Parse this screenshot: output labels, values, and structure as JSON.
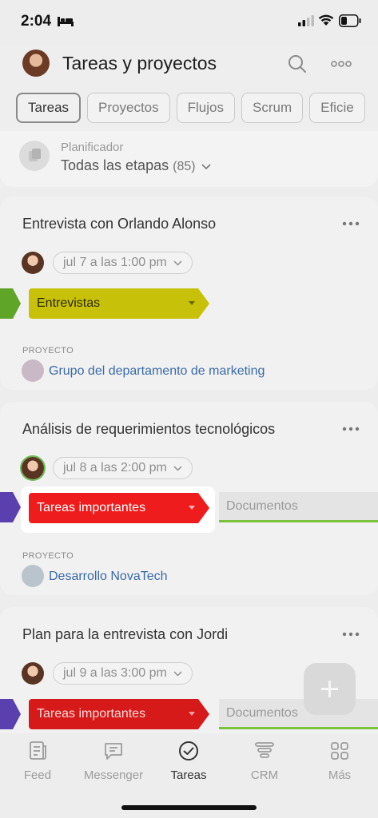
{
  "status_bar": {
    "time": "2:04"
  },
  "header": {
    "title": "Tareas y proyectos",
    "tabs": [
      {
        "label": "Tareas",
        "active": true
      },
      {
        "label": "Proyectos",
        "active": false
      },
      {
        "label": "Flujos",
        "active": false
      },
      {
        "label": "Scrum",
        "active": false
      },
      {
        "label": "Eficie",
        "active": false
      }
    ],
    "planner": {
      "label": "Planificador",
      "value": "Todas las etapas",
      "count": "(85)"
    }
  },
  "tasks": [
    {
      "title": "Entrevista con Orlando Alonso",
      "date": "jul 7 a las 1:00 pm",
      "stage": "Entrevistas",
      "stage_color": "#c8c10a",
      "prev_stage_color": "#5fa528",
      "project_label": "PROYECTO",
      "project": "Grupo del departamento de marketing"
    },
    {
      "title": "Análisis de requerimientos tecnológicos",
      "date": "jul 8 a las 2:00 pm",
      "stage": "Tareas importantes",
      "stage_color": "#ee1c1c",
      "prev_stage_color": "#5a3fae",
      "next_stage": "Documentos",
      "project_label": "PROYECTO",
      "project": "Desarrollo NovaTech"
    },
    {
      "title": "Plan para la entrevista con Jordi",
      "date": "jul 9 a las 3:00 pm",
      "stage": "Tareas importantes",
      "stage_color": "#d61a1a",
      "prev_stage_color": "#5a3fae",
      "next_stage": "Documentos"
    }
  ],
  "tabbar": [
    {
      "label": "Feed",
      "icon": "feed-icon"
    },
    {
      "label": "Messenger",
      "icon": "chat-icon"
    },
    {
      "label": "Tareas",
      "icon": "check-circle-icon",
      "active": true
    },
    {
      "label": "CRM",
      "icon": "funnel-icon"
    },
    {
      "label": "Más",
      "icon": "grid-icon"
    }
  ]
}
